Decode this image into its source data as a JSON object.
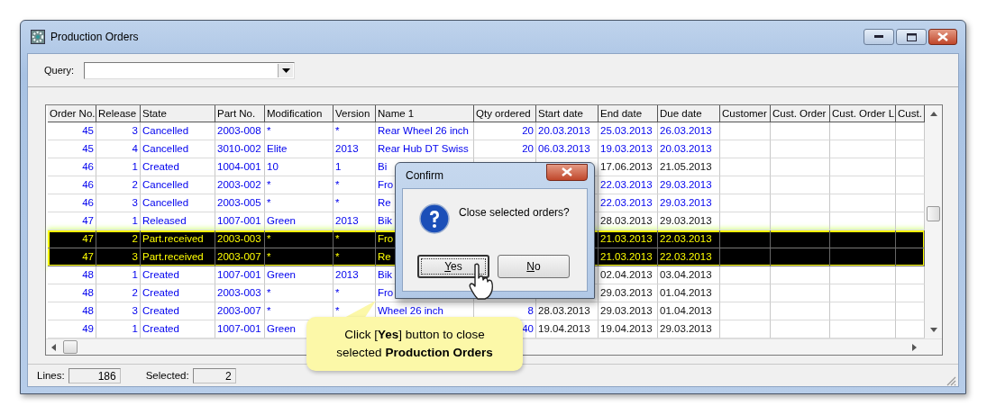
{
  "window": {
    "title": "Production Orders"
  },
  "query": {
    "label": "Query:"
  },
  "table": {
    "columns": [
      "Order No.",
      "Release",
      "State",
      "Part No.",
      "Modification",
      "Version",
      "Name 1",
      "Qty ordered",
      "Start date",
      "End date",
      "Due date",
      "Customer",
      "Cust. Order",
      "Cust. Order L",
      "Cust."
    ],
    "rows": [
      {
        "cells": [
          "45",
          "3",
          "Cancelled",
          "2003-008",
          "*",
          "*",
          "Rear Wheel 26 inch",
          "20",
          "20.03.2013",
          "25.03.2013",
          "26.03.2013"
        ],
        "selected": false,
        "dates_plain": false
      },
      {
        "cells": [
          "45",
          "4",
          "Cancelled",
          "3010-002",
          "Elite",
          "2013",
          "Rear Hub DT Swiss",
          "20",
          "06.03.2013",
          "19.03.2013",
          "20.03.2013"
        ],
        "selected": false,
        "dates_plain": false
      },
      {
        "cells": [
          "46",
          "1",
          "Created",
          "1004-001",
          "10",
          "1",
          "Bi",
          null,
          null,
          "17.06.2013",
          "21.05.2013"
        ],
        "selected": false,
        "dates_plain": true
      },
      {
        "cells": [
          "46",
          "2",
          "Cancelled",
          "2003-002",
          "*",
          "*",
          "Fro",
          null,
          null,
          "22.03.2013",
          "29.03.2013"
        ],
        "selected": false,
        "dates_plain": false
      },
      {
        "cells": [
          "46",
          "3",
          "Cancelled",
          "2003-005",
          "*",
          "*",
          "Re",
          null,
          null,
          "22.03.2013",
          "29.03.2013"
        ],
        "selected": false,
        "dates_plain": false
      },
      {
        "cells": [
          "47",
          "1",
          "Released",
          "1007-001",
          "Green",
          "2013",
          "Bik",
          null,
          null,
          "28.03.2013",
          "29.03.2013"
        ],
        "selected": false,
        "dates_plain": true
      },
      {
        "cells": [
          "47",
          "2",
          "Part.received",
          "2003-003",
          "*",
          "*",
          "Fro",
          null,
          null,
          "21.03.2013",
          "22.03.2013"
        ],
        "selected": true
      },
      {
        "cells": [
          "47",
          "3",
          "Part.received",
          "2003-007",
          "*",
          "*",
          "Re",
          null,
          null,
          "21.03.2013",
          "22.03.2013"
        ],
        "selected": true
      },
      {
        "cells": [
          "48",
          "1",
          "Created",
          "1007-001",
          "Green",
          "2013",
          "Bik",
          null,
          null,
          "02.04.2013",
          "03.04.2013"
        ],
        "selected": false,
        "dates_plain": true
      },
      {
        "cells": [
          "48",
          "2",
          "Created",
          "2003-003",
          "*",
          "*",
          "Fro",
          null,
          null,
          "29.03.2013",
          "01.04.2013"
        ],
        "selected": false,
        "dates_plain": true
      },
      {
        "cells": [
          "48",
          "3",
          "Created",
          "2003-007",
          "*",
          "*",
          "Wheel 26 inch",
          "8",
          "28.03.2013",
          "29.03.2013",
          "01.04.2013"
        ],
        "selected": false,
        "dates_plain": true
      },
      {
        "cells": [
          "49",
          "1",
          "Created",
          "1007-001",
          "Green",
          null,
          null,
          "40",
          "19.04.2013",
          "19.04.2013",
          "29.03.2013"
        ],
        "selected": false,
        "dates_plain": true
      }
    ]
  },
  "confirm_dialog": {
    "title": "Confirm",
    "message": "Close selected orders?",
    "buttons": [
      {
        "mnemonic": "Y",
        "rest": "es",
        "focused": true
      },
      {
        "mnemonic": "N",
        "rest": "o",
        "focused": false
      }
    ]
  },
  "callout": {
    "text": "Click [**Yes**] button to close selected **Production Orders**"
  },
  "status_bar": {
    "lines_label": "Lines:",
    "lines": "186",
    "selected_label": "Selected:",
    "selected": "2"
  }
}
